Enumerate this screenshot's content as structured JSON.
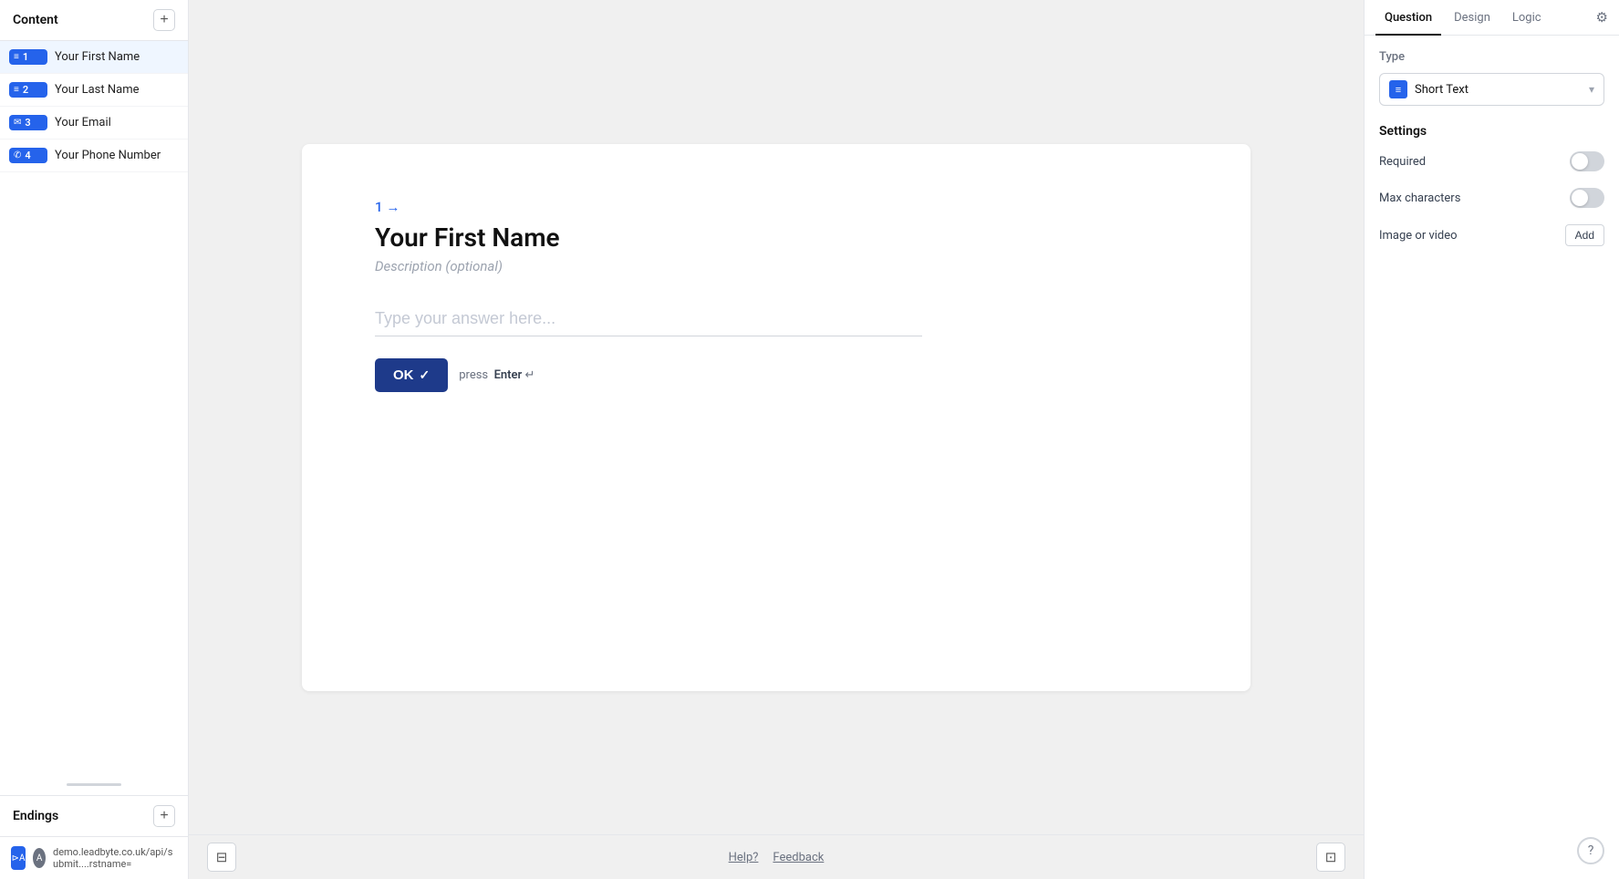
{
  "sidebar": {
    "content_title": "Content",
    "add_button_label": "+",
    "items": [
      {
        "id": 1,
        "icon": "≡",
        "label": "Your First Name",
        "active": true
      },
      {
        "id": 2,
        "icon": "≡",
        "label": "Your Last Name",
        "active": false
      },
      {
        "id": 3,
        "icon": "✉",
        "label": "Your Email",
        "active": false
      },
      {
        "id": 4,
        "icon": "✆",
        "label": "Your Phone Number",
        "active": false
      }
    ],
    "endings_title": "Endings",
    "endings_add": "+",
    "footer_url": "demo.leadbyte.co.uk/api/submit....rstname="
  },
  "main": {
    "question_number": "1",
    "question_arrow": "→",
    "question_title": "Your First Name",
    "question_desc": "Description (optional)",
    "answer_placeholder": "Type your answer here...",
    "ok_label": "OK",
    "ok_check": "✓",
    "press_hint": "press",
    "enter_label": "Enter",
    "enter_symbol": "↵",
    "help_label": "Help?",
    "feedback_label": "Feedback"
  },
  "right_panel": {
    "tabs": [
      {
        "id": "question",
        "label": "Question",
        "active": true
      },
      {
        "id": "design",
        "label": "Design",
        "active": false
      },
      {
        "id": "logic",
        "label": "Logic",
        "active": false
      }
    ],
    "type_section_label": "Type",
    "type_icon": "≡",
    "type_value": "Short Text",
    "type_chevron": "▾",
    "settings_title": "Settings",
    "required_label": "Required",
    "required_on": false,
    "max_characters_label": "Max characters",
    "max_characters_on": false,
    "image_video_label": "Image or video",
    "add_label": "Add"
  }
}
